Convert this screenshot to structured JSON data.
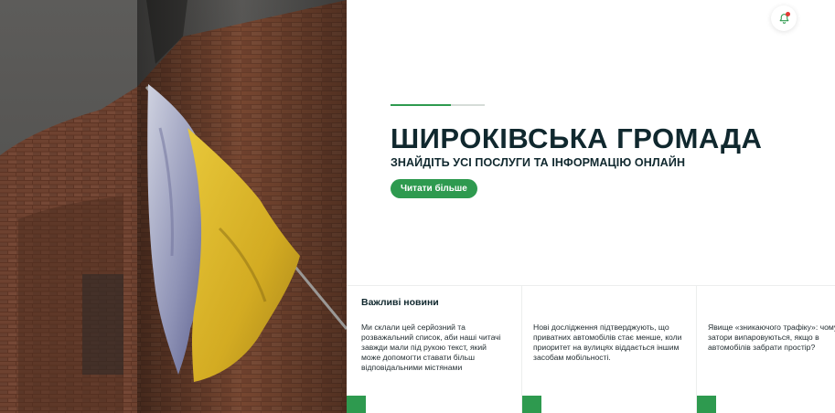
{
  "hero": {
    "title": "ШИРОКІВСЬКА ГРОМАДА",
    "subtitle": "ЗНАЙДІТЬ УСІ ПОСЛУГИ ТА ІНФОРМАЦІЮ ОНЛАЙН",
    "button_label": "Читати більше",
    "photo_icon": "ukrainian-flag-photo"
  },
  "header": {
    "notification_icon": "bell-icon",
    "has_unread": true
  },
  "news": {
    "heading": "Важливі новини",
    "items": [
      {
        "text": "Ми склали цей серйозний та розважальний список, аби наші читачі завжди мали під рукою текст, який може допомогти ставати більш відповідальними містянами"
      },
      {
        "text": "Нові дослідження підтверджують, що приватних автомобілів стає менше, коли приоритет на вулицях віддається іншим засобам мобільності."
      },
      {
        "text": "Явище «зникаючого трафіку»: чому затори випаровуються, якщо в автомобілів забрати простір?"
      }
    ]
  },
  "colors": {
    "accent": "#2e9a4f",
    "heading": "#10282e",
    "notification_dot": "#e53935"
  }
}
